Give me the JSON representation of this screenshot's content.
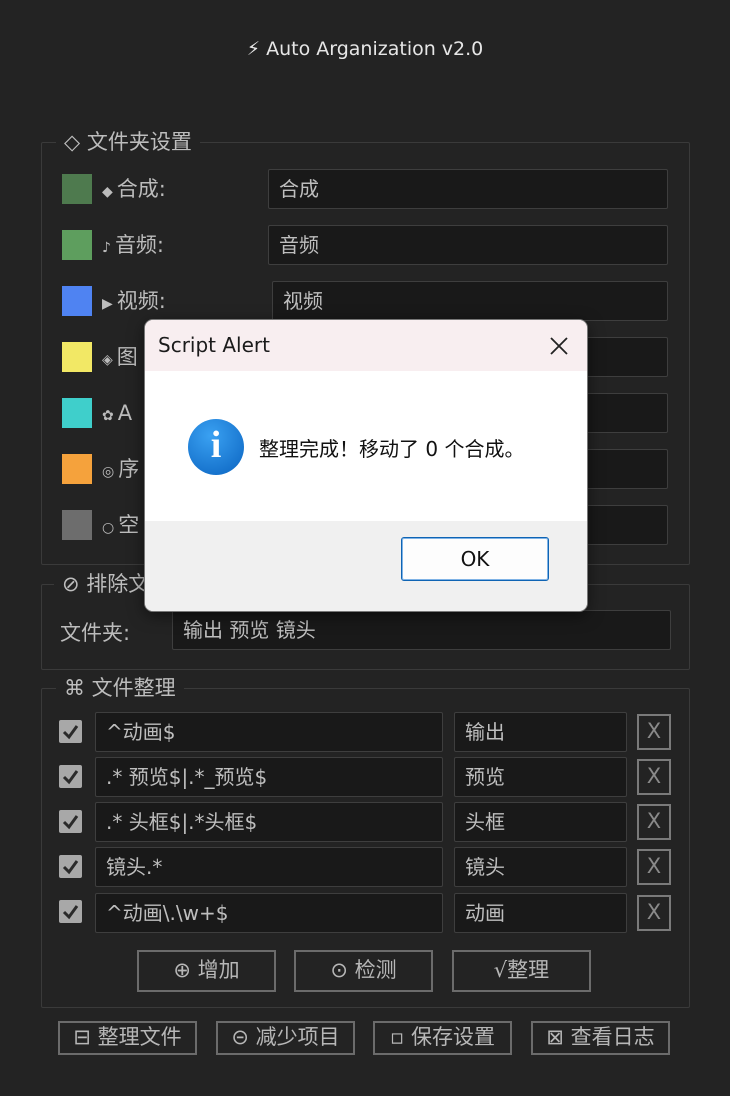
{
  "app": {
    "title": "⚡ Auto Arganization v2.0"
  },
  "folder_settings": {
    "label": "◇ 文件夹设置",
    "rows": [
      {
        "glyph": "◆",
        "label": "合成:",
        "value": "合成",
        "color": "#4e7a4e"
      },
      {
        "glyph": "♪",
        "label": "音频:",
        "value": "音频",
        "color": "#5e9e5e"
      },
      {
        "glyph": "▶",
        "label": "视频:",
        "value": "视频",
        "color": "#4f83f2"
      },
      {
        "glyph": "◈",
        "label": "图",
        "value": "",
        "color": "#f2e865"
      },
      {
        "glyph": "✿",
        "label": "A",
        "value": "",
        "color": "#3fcfcb"
      },
      {
        "glyph": "◎",
        "label": "序",
        "value": "",
        "color": "#f5a23c"
      },
      {
        "glyph": "○",
        "label": "空",
        "value": "",
        "color": "#6d6d6d"
      }
    ]
  },
  "exclude": {
    "label": "⊘ 排除文",
    "field_label": "文件夹:",
    "value": "输出 预览 镜头"
  },
  "organize": {
    "label": "⌘ 文件整理",
    "rules": [
      {
        "checked": true,
        "pattern": "^动画$",
        "target": "输出",
        "remove": "X"
      },
      {
        "checked": true,
        "pattern": ".* 预览$|.*_预览$",
        "target": "预览",
        "remove": "X"
      },
      {
        "checked": true,
        "pattern": ".* 头框$|.*头框$",
        "target": "头框",
        "remove": "X"
      },
      {
        "checked": true,
        "pattern": "镜头.*",
        "target": "镜头",
        "remove": "X"
      },
      {
        "checked": true,
        "pattern": "^动画\\.\\w+$",
        "target": "动画",
        "remove": "X"
      }
    ],
    "buttons": {
      "add": "⊕ 增加",
      "detect": "⊙ 检测",
      "organize": "√整理"
    }
  },
  "bottom_buttons": {
    "organize_files": "⊟ 整理文件",
    "reduce_items": "⊝ 减少项目",
    "save_settings": "▫ 保存设置",
    "view_log": "⊠ 查看日志"
  },
  "dialog": {
    "title": "Script Alert",
    "message": "整理完成！移动了 0 个合成。",
    "ok_label": "OK",
    "icon": "info-icon"
  }
}
